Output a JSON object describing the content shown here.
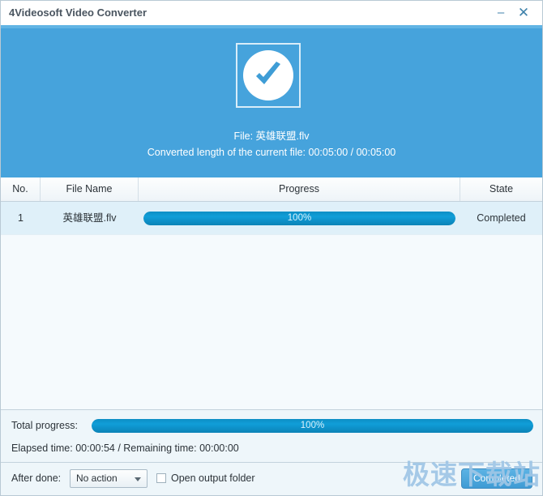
{
  "window": {
    "title": "4Videosoft Video Converter",
    "minimize_label": "–",
    "close_label": "✕"
  },
  "hero": {
    "status_icon": "check-circle-icon",
    "file_line": "File: 英雄联盟.flv",
    "converted_length_line": "Converted length of the current file: 00:05:00 / 00:05:00"
  },
  "table": {
    "columns": [
      "No.",
      "File Name",
      "Progress",
      "State"
    ],
    "rows": [
      {
        "no": "1",
        "file_name": "英雄联盟.flv",
        "progress_text": "100%",
        "progress_percent": 100,
        "state": "Completed"
      }
    ]
  },
  "total": {
    "label": "Total progress:",
    "progress_text": "100%",
    "progress_percent": 100,
    "times": "Elapsed time: 00:00:54 / Remaining time: 00:00:00"
  },
  "footer": {
    "after_done_label": "After done:",
    "after_done_value": "No action",
    "open_output_folder_label": "Open output folder",
    "open_output_folder_checked": false,
    "action_button_label": "Completed"
  },
  "watermark": {
    "text": "极速下载站"
  },
  "colors": {
    "accent_blue": "#46a3dc",
    "progress_blue": "#109ed8",
    "title_text": "#4a5560",
    "panel_bg": "#eef6fa"
  }
}
